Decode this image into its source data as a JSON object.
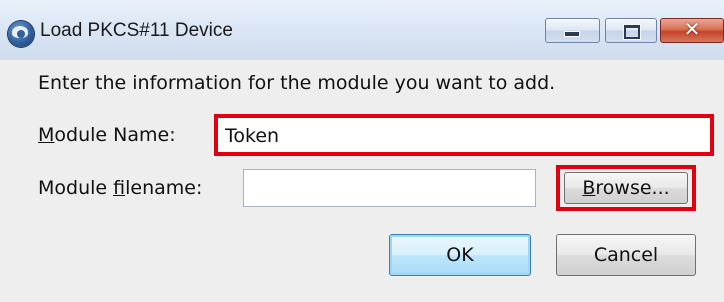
{
  "window": {
    "title": "Load PKCS#11 Device",
    "icon": "thunderbird-app-icon",
    "controls": {
      "minimize_icon": "minimize-icon",
      "maximize_icon": "maximize-icon",
      "close_glyph": "✕"
    }
  },
  "form": {
    "instruction": "Enter the information for the module you want to add.",
    "module_name": {
      "label_accesskey": "M",
      "label_rest": "odule Name:",
      "value": "Token"
    },
    "module_filename": {
      "label_before": "Module ",
      "label_accesskey": "f",
      "label_after": "ilename:",
      "value": ""
    },
    "browse": {
      "label_accesskey": "B",
      "label_rest": "rowse..."
    }
  },
  "buttons": {
    "ok_label": "OK",
    "cancel_label": "Cancel"
  },
  "colors": {
    "highlight": "#e0000f",
    "dialog_background": "#eeeeee",
    "close_button": "#c5432a"
  }
}
